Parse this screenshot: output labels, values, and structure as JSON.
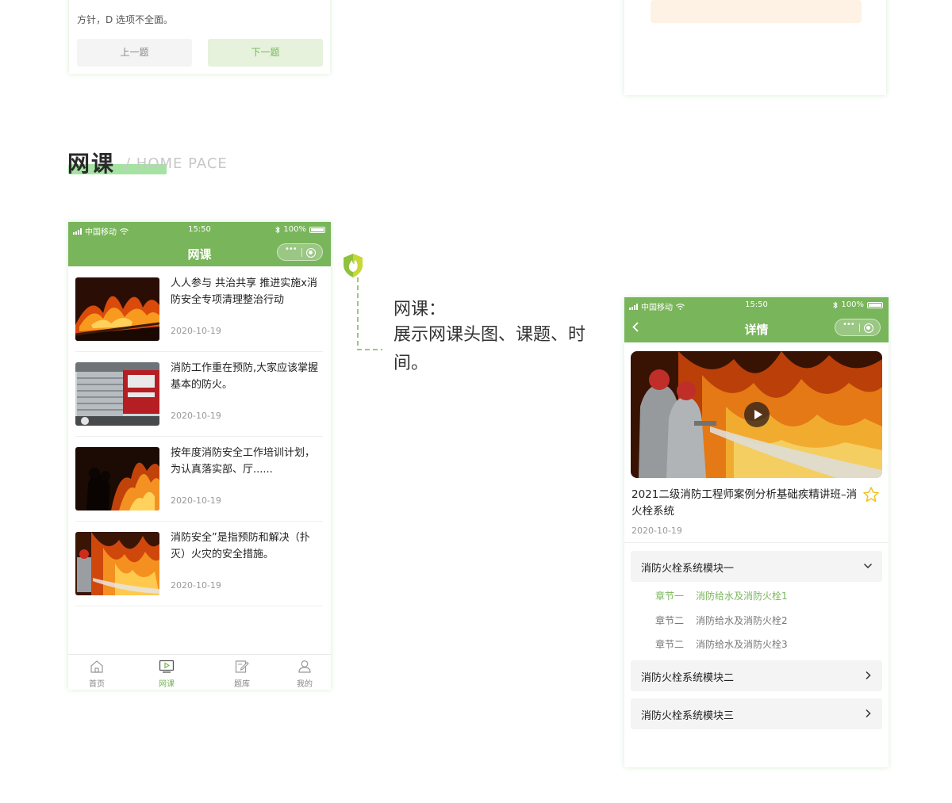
{
  "quiz_fragment": {
    "text": "方针，D 选项不全面。",
    "prev_label": "上一题",
    "next_label": "下一题"
  },
  "section": {
    "title": "网课",
    "subtitle": "/ HOME PACE"
  },
  "status_bar": {
    "carrier": "中国移动",
    "time": "15:50",
    "battery": "100%"
  },
  "list_screen": {
    "nav_title": "网课",
    "items": [
      {
        "title": "人人参与 共治共享 推进实施x消防安全专项清理整治行动",
        "date": "2020-10-19"
      },
      {
        "title": "消防工作重在预防,大家应该掌握基本的防火。",
        "date": "2020-10-19"
      },
      {
        "title": "按年度消防安全工作培训计划，为认真落实部、厅......",
        "date": "2020-10-19"
      },
      {
        "title": "消防安全”是指预防和解决（扑灭）火灾的安全措施。",
        "date": "2020-10-19"
      }
    ],
    "tabs": [
      {
        "label": "首页",
        "icon": "home-icon"
      },
      {
        "label": "网课",
        "icon": "video-icon",
        "active": true
      },
      {
        "label": "题库",
        "icon": "edit-icon"
      },
      {
        "label": "我的",
        "icon": "user-icon"
      }
    ]
  },
  "annotation": {
    "title": "网课：",
    "body": "展示网课头图、课题、时间。"
  },
  "detail_screen": {
    "nav_title": "详情",
    "course_title": "2021二级消防工程师案例分析基础疾精讲班–消火栓系统",
    "date": "2020-10-19",
    "modules": [
      {
        "label": "消防火栓系统模块一",
        "expanded": true,
        "chapters": [
          {
            "num": "章节一",
            "name": "消防给水及消防火栓1",
            "active": true
          },
          {
            "num": "章节二",
            "name": "消防给水及消防火栓2"
          },
          {
            "num": "章节二",
            "name": "消防给水及消防火栓3"
          }
        ]
      },
      {
        "label": "消防火栓系统模块二",
        "expanded": false
      },
      {
        "label": "消防火栓系统模块三",
        "expanded": false
      }
    ]
  },
  "colors": {
    "brand_green": "#79b55a",
    "title_highlight": "#a6e2a3",
    "active_text": "#79b55a"
  }
}
